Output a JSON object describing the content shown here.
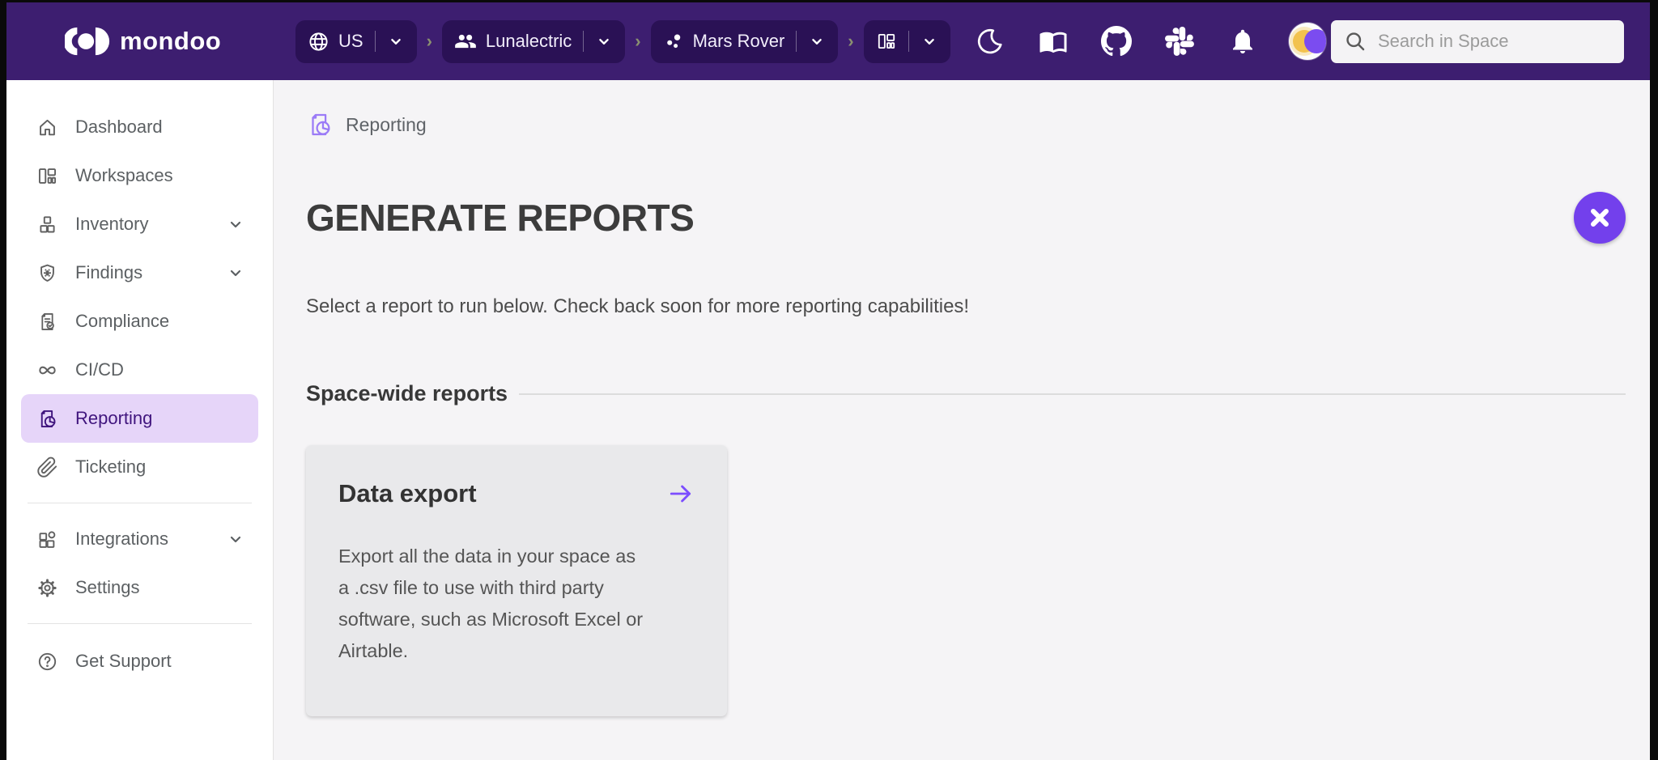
{
  "header": {
    "logo_text": "mondoo",
    "region_label": "US",
    "org_label": "Lunalectric",
    "space_label": "Mars Rover",
    "crumb_separator": "›",
    "search_placeholder": "Search in Space"
  },
  "sidebar": {
    "items": [
      {
        "label": "Dashboard"
      },
      {
        "label": "Workspaces"
      },
      {
        "label": "Inventory"
      },
      {
        "label": "Findings"
      },
      {
        "label": "Compliance"
      },
      {
        "label": "CI/CD"
      },
      {
        "label": "Reporting"
      },
      {
        "label": "Ticketing"
      },
      {
        "label": "Integrations"
      },
      {
        "label": "Settings"
      },
      {
        "label": "Get Support"
      }
    ]
  },
  "main": {
    "breadcrumb_label": "Reporting",
    "page_title": "GENERATE REPORTS",
    "intro": "Select a report to run below. Check back soon for more reporting capabilities!",
    "section_title": "Space-wide reports",
    "cards": [
      {
        "title": "Data export",
        "description": "Export all the data in your space as a .csv file to use with third party software, such as Microsoft Excel or Airtable."
      }
    ]
  },
  "colors": {
    "header_bg": "#3d1e70",
    "chip_bg": "#2a1155",
    "accent_purple": "#7c4dff",
    "close_button": "#7340ec",
    "selected_item_bg": "#e6d5f9",
    "selected_item_text": "#40157e",
    "main_bg": "#f5f4f6",
    "card_bg": "#e9e9eb"
  }
}
